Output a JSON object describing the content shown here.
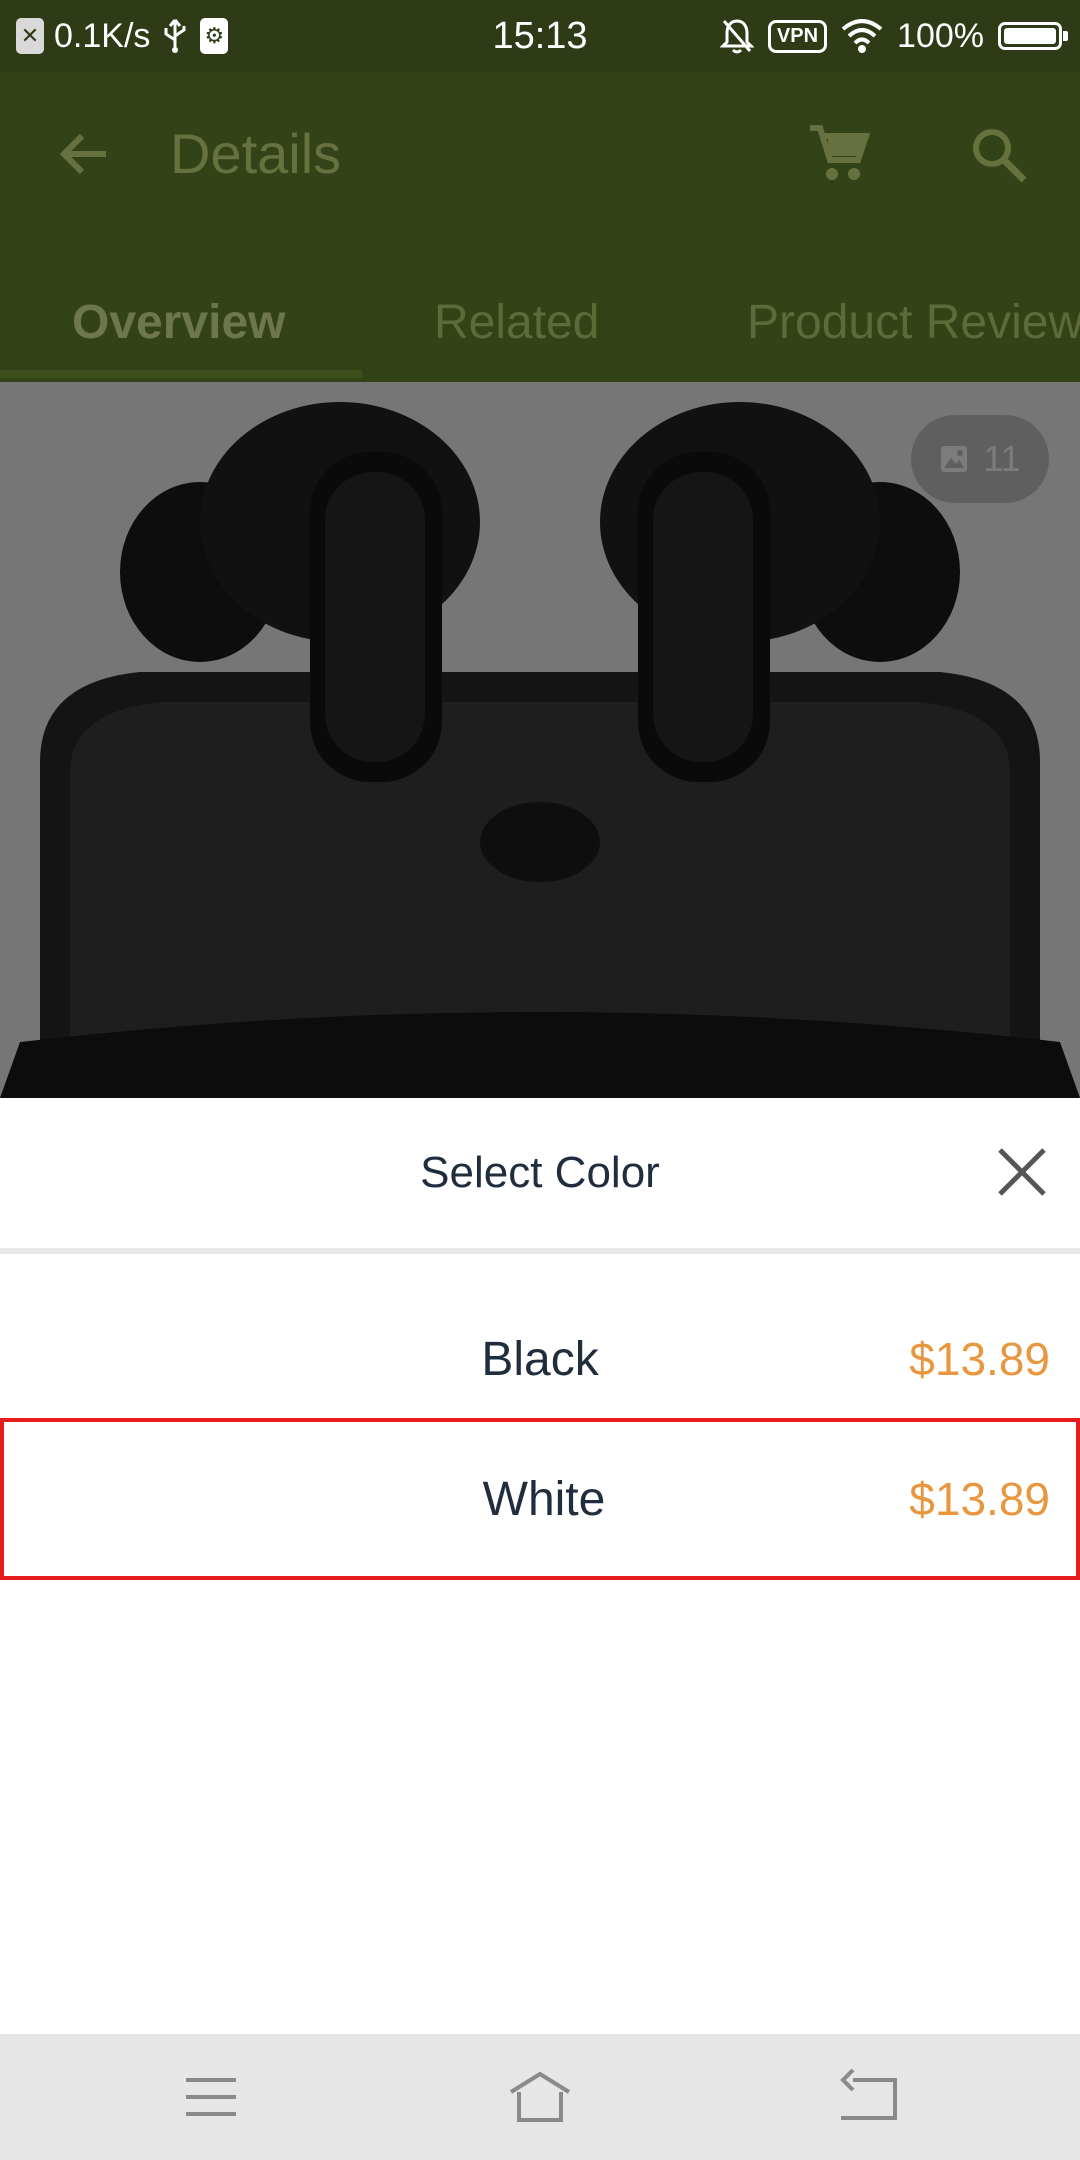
{
  "status_bar": {
    "net_speed": "0.1K/s",
    "time": "15:13",
    "vpn": "VPN",
    "battery": "100%"
  },
  "header": {
    "title": "Details"
  },
  "tabs": [
    {
      "label": "Overview",
      "active": true
    },
    {
      "label": "Related",
      "active": false
    },
    {
      "label": "Product Reviews",
      "active": false
    }
  ],
  "product": {
    "photo_count": "11"
  },
  "sheet": {
    "title": "Select Color",
    "options": [
      {
        "name": "Black",
        "price": "$13.89",
        "selected": false
      },
      {
        "name": "White",
        "price": "$13.89",
        "selected": true
      }
    ]
  },
  "colors": {
    "header_bg": "#334317",
    "price": "#e8973f",
    "highlight_border": "#e61d1d"
  }
}
